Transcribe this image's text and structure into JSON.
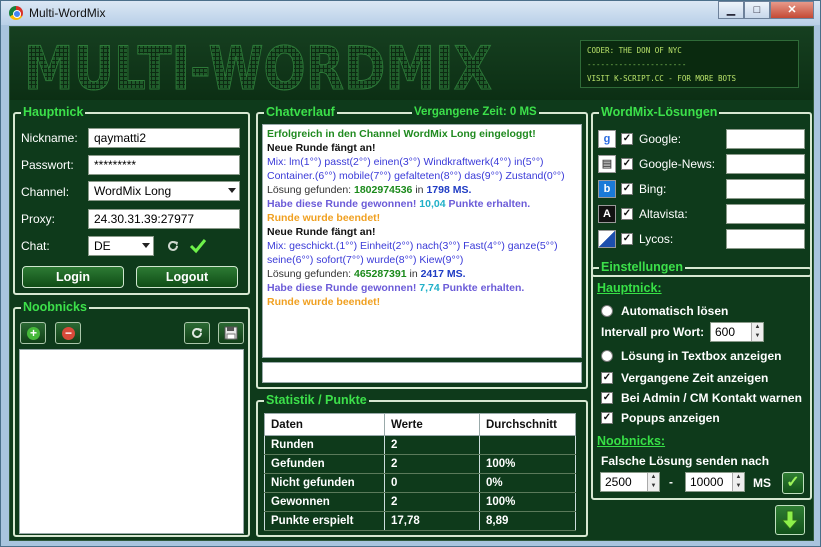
{
  "window": {
    "title": "Multi-WordMix",
    "min_glyph": "▁",
    "max_glyph": "□",
    "close_glyph": "✕"
  },
  "banner": {
    "logo_text": "MULTI-WORDMIX",
    "credits": [
      "CODER: THE DON OF NYC",
      "----------------------",
      "VISIT K-SCRIPT.CC - FOR MORE BOTS"
    ]
  },
  "hauptnick": {
    "title": "Hauptnick",
    "nickname_label": "Nickname:",
    "nickname_value": "qaymatti2",
    "password_label": "Passwort:",
    "password_value": "*********",
    "channel_label": "Channel:",
    "channel_value": "WordMix Long",
    "proxy_label": "Proxy:",
    "proxy_value": "24.30.31.39:27977",
    "chat_label": "Chat:",
    "chat_value": "DE",
    "login_label": "Login",
    "logout_label": "Logout"
  },
  "noobnicks": {
    "title": "Noobnicks"
  },
  "chat": {
    "title": "Chatverlauf",
    "elapsed": "Vergangene Zeit: 0 MS",
    "round1_mix": "Mix: lm(1°°) passt(2°°) einen(3°°) Windkraftwerk(4°°) in(5°°)",
    "round1_mix2": "Container.(6°°) mobile(7°°) gefalteten(8°°) das(9°°) Zustand(0°°)",
    "round2_mix": "Mix: geschickt.(1°°) Einheit(2°°) nach(3°°) Fast(4°°) ganze(5°°)",
    "round2_mix2": "seine(6°°) sofort(7°°) wurde(8°°) Kiew(9°°)",
    "lines": {
      "connected": "Erfolgreich in den Channel WordMix Long eingeloggt!",
      "new_round": "Neue Runde fängt an!",
      "solution_found": "Lösung gefunden:",
      "in": "in",
      "won_prefix": "Habe diese Runde gewonnen!",
      "points_suffix": "Punkte erhalten.",
      "round_ended": "Runde wurde beendet!"
    },
    "round1": {
      "solution": "1802974536",
      "time": "1798 MS.",
      "points": "10,04"
    },
    "round2": {
      "solution": "465287391",
      "time": "2417 MS.",
      "points": "7,74"
    }
  },
  "stats": {
    "title": "Statistik / Punkte",
    "headers": [
      "Daten",
      "Werte",
      "Durchschnitt"
    ],
    "rows": [
      [
        "Runden",
        "2",
        ""
      ],
      [
        "Gefunden",
        "2",
        "100%"
      ],
      [
        "Nicht gefunden",
        "0",
        "0%"
      ],
      [
        "Gewonnen",
        "2",
        "100%"
      ],
      [
        "Punkte erspielt",
        "17,78",
        "8,89"
      ]
    ]
  },
  "solutions": {
    "title": "WordMix-Lösungen",
    "engines": [
      {
        "name": "Google:",
        "icon": "google-icon",
        "checked": true
      },
      {
        "name": "Google-News:",
        "icon": "google-news-icon",
        "checked": true
      },
      {
        "name": "Bing:",
        "icon": "bing-icon",
        "checked": true
      },
      {
        "name": "Altavista:",
        "icon": "altavista-icon",
        "checked": true
      },
      {
        "name": "Lycos:",
        "icon": "lycos-icon",
        "checked": true
      }
    ]
  },
  "settings": {
    "title": "Einstellungen",
    "hauptnick_label": "Hauptnick:",
    "auto_solve": "Automatisch lösen",
    "interval_label": "Intervall pro Wort:",
    "interval_value": "600",
    "show_in_textbox": "Lösung in Textbox anzeigen",
    "show_elapsed": "Vergangene Zeit anzeigen",
    "admin_warn": "Bei Admin / CM Kontakt warnen",
    "popups": "Popups anzeigen",
    "noobnicks_label": "Noobnicks:",
    "wrong_solution_label": "Falsche Lösung senden nach",
    "from_value": "2500",
    "dash": "-",
    "to_value": "10000",
    "unit": "MS"
  },
  "colors": {
    "accent_green": "#3ce04a",
    "background": "#0e3a1b"
  }
}
